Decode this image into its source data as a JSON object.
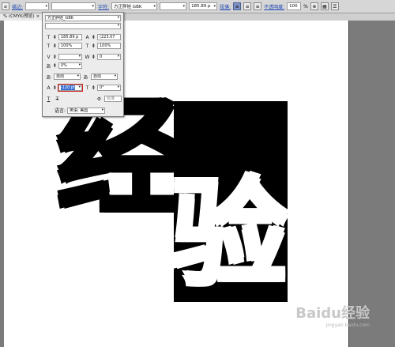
{
  "control_bar": {
    "fill_label": "描边:",
    "char_label": "字符:",
    "font_name": "方正胖娃 GBK",
    "size_value": "185.89 p",
    "para_label": "段落:",
    "opacity_label": "不透明度:",
    "opacity_value": "100",
    "percent": "%"
  },
  "tab": {
    "title": "% (CMYK/预览)",
    "close": "×"
  },
  "char_panel": {
    "font_family": "方正胖娃_GBK",
    "font_style": "",
    "font_size": "185.89 p",
    "leading": "(223.07",
    "horiz_scale": "100%",
    "vert_scale": "100%",
    "kerning": "",
    "tracking": "0",
    "tsume": "0%",
    "aki_left": "自动",
    "aki_right": "自动",
    "baseline_shift": "-120 pt",
    "rotation": "0°",
    "underline_T": "T",
    "strike_T": "T",
    "disabled": "标准",
    "lang_label": "语言:",
    "lang_value": "英语: 美国"
  },
  "artwork": {
    "char1": "经",
    "char2": "验"
  },
  "watermark": {
    "main": "Baidu经验",
    "sub": "jingyan.baidu.com"
  },
  "colors": {
    "accent": "#1a45b0",
    "highlight": "#d02020",
    "selection": "#3b6fd6"
  }
}
